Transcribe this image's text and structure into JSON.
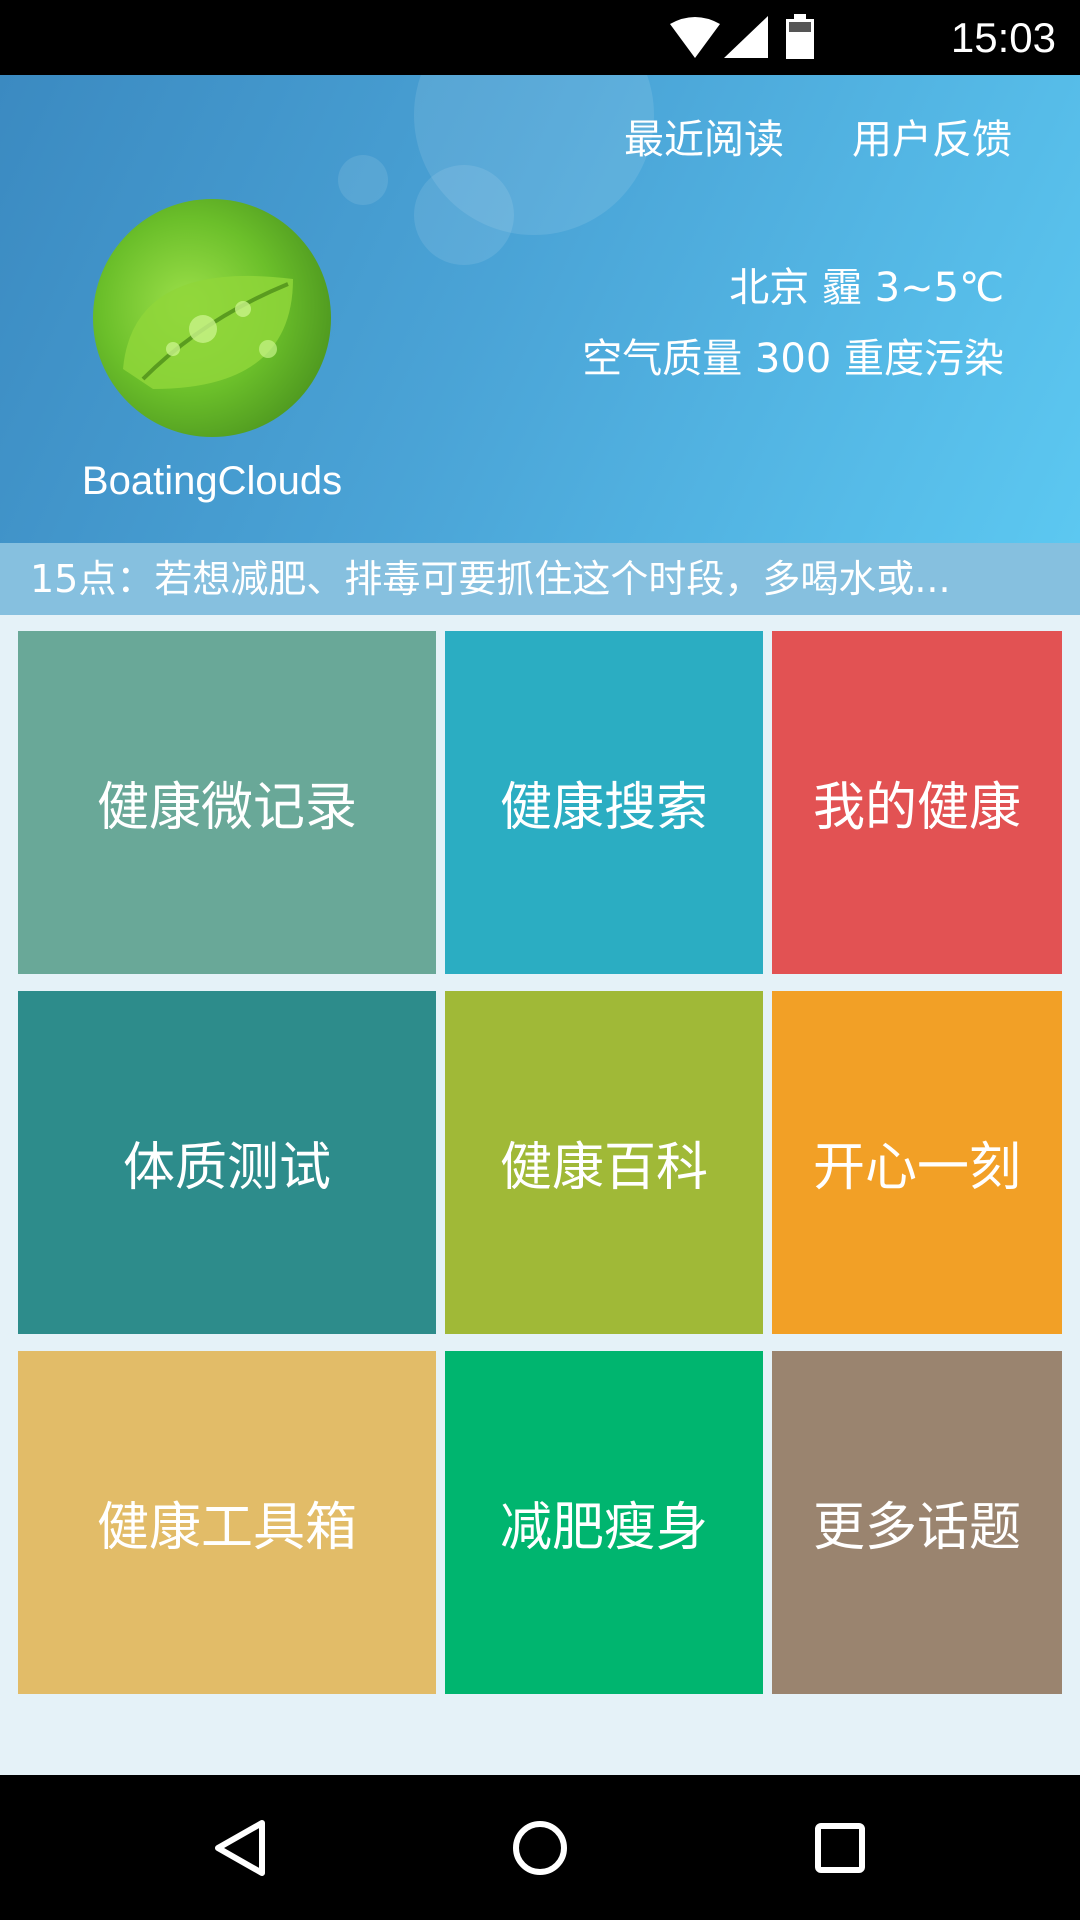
{
  "status_bar": {
    "time": "15:03"
  },
  "header": {
    "links": [
      "最近阅读",
      "用户反馈"
    ],
    "username": "BoatingClouds",
    "weather": "北京 霾 3~5℃",
    "air_quality": "空气质量 300 重度污染"
  },
  "ticker": {
    "text": "15点：若想减肥、排毒可要抓住这个时段，多喝水或..."
  },
  "tiles": [
    {
      "label": "健康微记录",
      "color": "#69a898"
    },
    {
      "label": "健康搜索",
      "color": "#2badc2"
    },
    {
      "label": "我的健康",
      "color": "#e25253"
    },
    {
      "label": "体质测试",
      "color": "#2d8c8b"
    },
    {
      "label": "健康百科",
      "color": "#a0b937"
    },
    {
      "label": "开心一刻",
      "color": "#f2a026"
    },
    {
      "label": "健康工具箱",
      "color": "#e2bc68"
    },
    {
      "label": "减肥瘦身",
      "color": "#00b56f"
    },
    {
      "label": "更多话题",
      "color": "#9a846f"
    }
  ],
  "nav": {
    "icons": [
      "back-icon",
      "home-icon",
      "recents-icon"
    ]
  }
}
